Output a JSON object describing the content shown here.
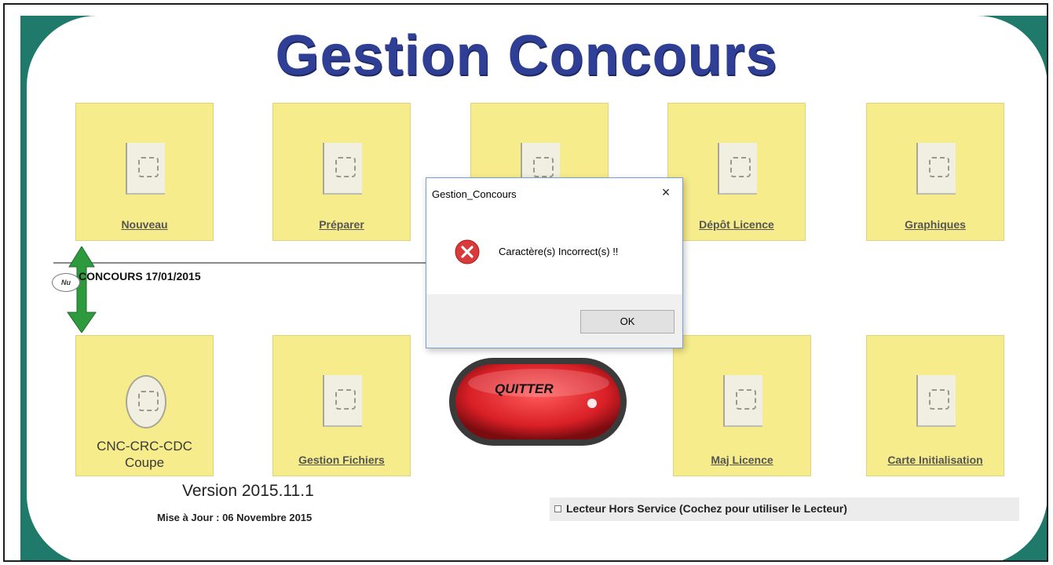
{
  "app": {
    "title": "Gestion Concours",
    "version": "Version 2015.11.1",
    "update": "Mise à Jour : 06 Novembre 2015"
  },
  "tiles_top": [
    {
      "label": "Nouveau",
      "icon": "new-icon"
    },
    {
      "label": "Préparer",
      "icon": "prepare-icon"
    },
    {
      "label": "",
      "icon": "print-icon"
    },
    {
      "label": "Dépôt Licence",
      "icon": "license-deposit-icon"
    },
    {
      "label": "Graphiques",
      "icon": "chart-icon"
    }
  ],
  "tiles_bottom": [
    {
      "label_line1": "CNC-CRC-CDC",
      "label_line2": "Coupe",
      "icon": "trophy-icon"
    },
    {
      "label": "Gestion Fichiers",
      "icon": "tools-icon"
    },
    {
      "label": "Maj Licence",
      "icon": "license-update-icon"
    },
    {
      "label": "Carte Initialisation",
      "icon": "card-icon"
    }
  ],
  "concours": {
    "badge": "Nu",
    "label": "CONCOURS 17/01/2015"
  },
  "quit": {
    "label": "QUITTER"
  },
  "reader": {
    "label": "Lecteur Hors Service (Cochez pour utiliser le Lecteur)",
    "checked": false
  },
  "dialog": {
    "title": "Gestion_Concours",
    "close": "×",
    "message": "Caractère(s) Incorrect(s) !!",
    "ok": "OK",
    "icon": "error-icon"
  },
  "colors": {
    "title": "#2f3f96",
    "tile": "#f7ec8b",
    "teal": "#1f7a6c",
    "quit_red": "#d81f26",
    "arrow_green": "#2e9a3e"
  }
}
